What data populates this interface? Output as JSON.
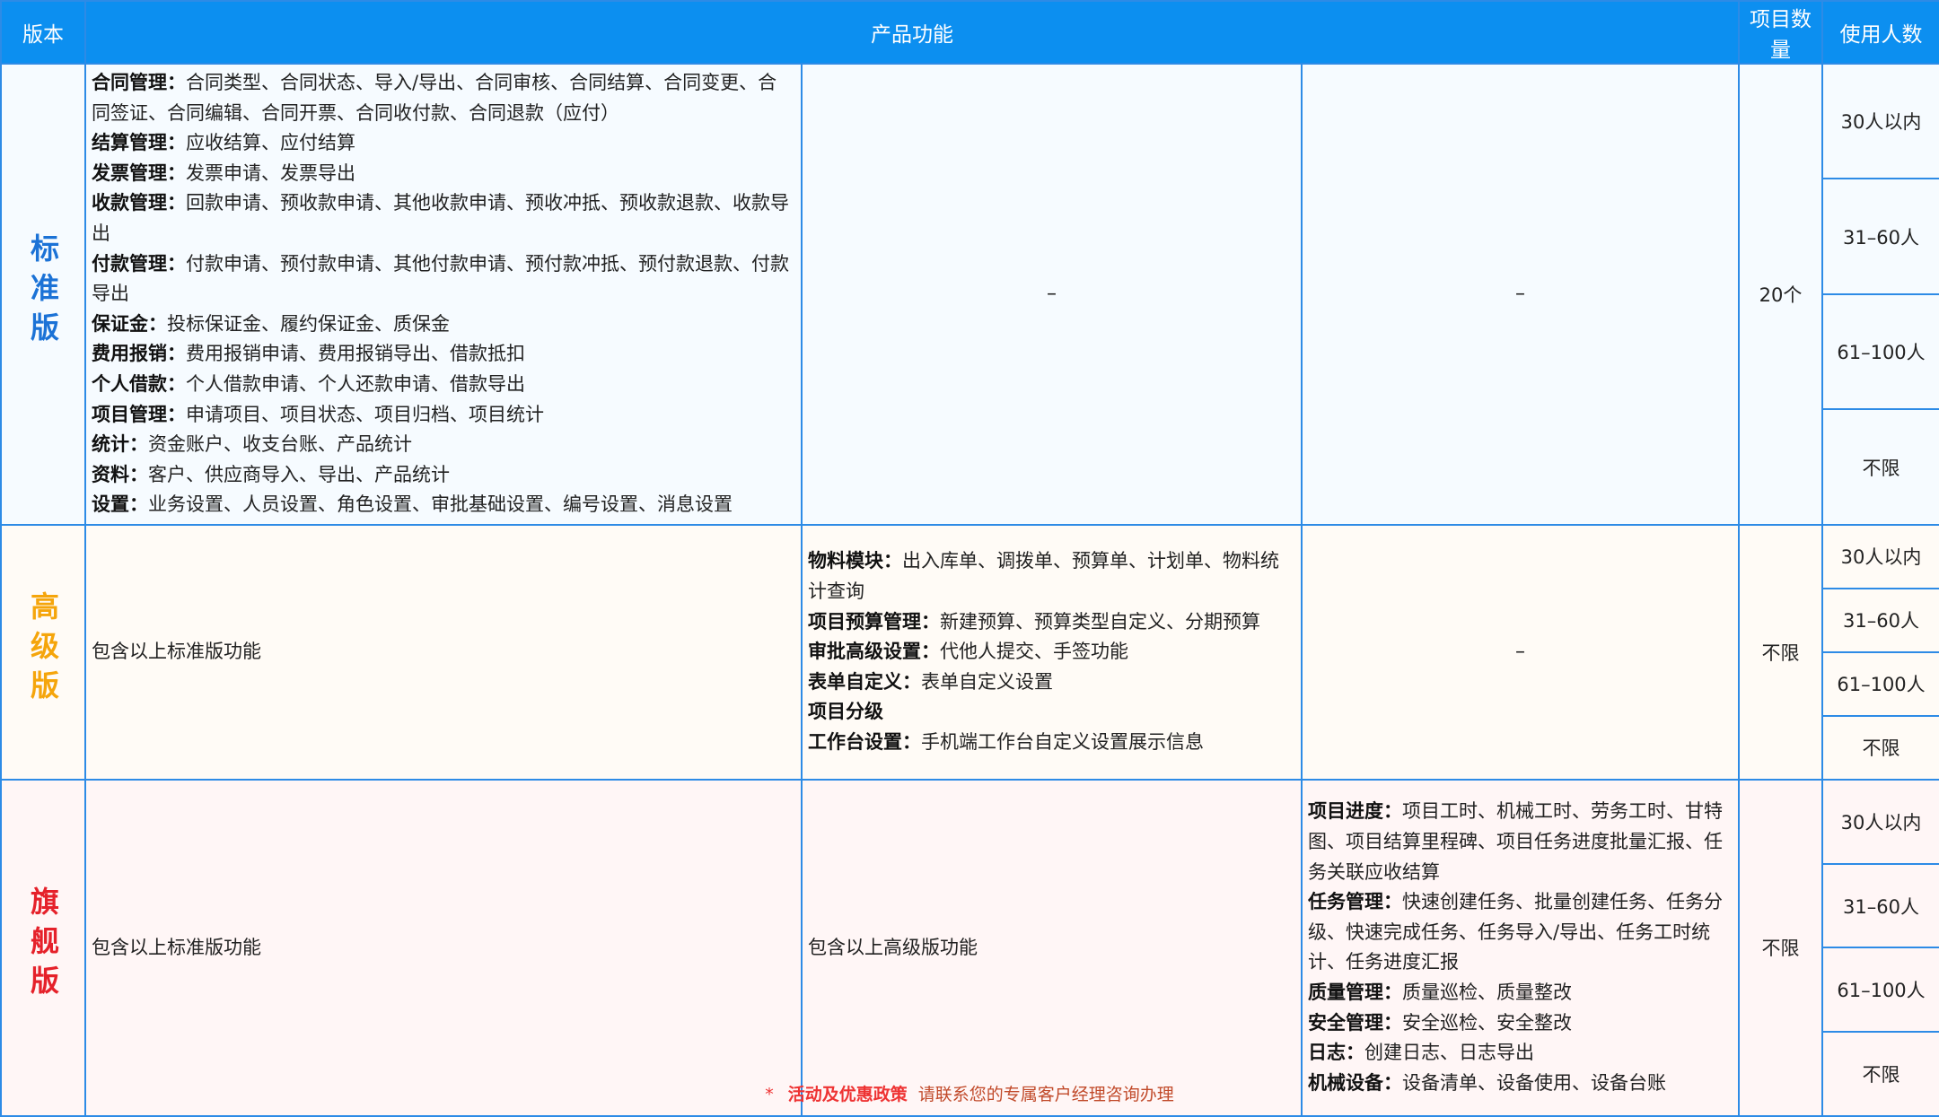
{
  "header": {
    "version": "版本",
    "features": "产品功能",
    "project_count": "项目数量",
    "users": "使用人数"
  },
  "standard": {
    "label": "标准版",
    "features": [
      {
        "k": "合同管理：",
        "v": "合同类型、合同状态、导入/导出、合同审核、合同结算、合同变更、合同签证、合同编辑、合同开票、合同收付款、合同退款（应付）"
      },
      {
        "k": "结算管理：",
        "v": "应收结算、应付结算"
      },
      {
        "k": "发票管理：",
        "v": "发票申请、发票导出"
      },
      {
        "k": "收款管理：",
        "v": "回款申请、预收款申请、其他收款申请、预收冲抵、预收款退款、收款导出"
      },
      {
        "k": "付款管理：",
        "v": "付款申请、预付款申请、其他付款申请、预付款冲抵、预付款退款、付款导出"
      },
      {
        "k": "保证金：",
        "v": "投标保证金、履约保证金、质保金"
      },
      {
        "k": "费用报销：",
        "v": "费用报销申请、费用报销导出、借款抵扣"
      },
      {
        "k": "个人借款：",
        "v": "个人借款申请、个人还款申请、借款导出"
      },
      {
        "k": "项目管理：",
        "v": "申请项目、项目状态、项目归档、项目统计"
      },
      {
        "k": "统计：",
        "v": "资金账户、收支台账、产品统计"
      },
      {
        "k": "资料：",
        "v": "客户、供应商导入、导出、产品统计"
      },
      {
        "k": "设置：",
        "v": "业务设置、人员设置、角色设置、审批基础设置、编号设置、消息设置"
      }
    ],
    "col2": "–",
    "col3": "–",
    "count": "20个",
    "users": [
      "30人以内",
      "31–60人",
      "61–100人",
      "不限"
    ]
  },
  "advanced": {
    "label": "高级版",
    "col1": "包含以上标准版功能",
    "features": [
      {
        "k": "物料模块：",
        "v": "出入库单、调拨单、预算单、计划单、物料统计查询"
      },
      {
        "k": "项目预算管理：",
        "v": "新建预算、预算类型自定义、分期预算"
      },
      {
        "k": "审批高级设置：",
        "v": "代他人提交、手签功能"
      },
      {
        "k": "表单自定义：",
        "v": "表单自定义设置"
      },
      {
        "k": "项目分级",
        "v": ""
      },
      {
        "k": "工作台设置：",
        "v": "手机端工作台自定义设置展示信息"
      }
    ],
    "col3": "–",
    "count": "不限",
    "users": [
      "30人以内",
      "31–60人",
      "61–100人",
      "不限"
    ]
  },
  "flagship": {
    "label": "旗舰版",
    "col1": "包含以上标准版功能",
    "col2": "包含以上高级版功能",
    "features": [
      {
        "k": "项目进度：",
        "v": "项目工时、机械工时、劳务工时、甘特图、项目结算里程碑、项目任务进度批量汇报、任务关联应收结算"
      },
      {
        "k": "任务管理：",
        "v": "快速创建任务、批量创建任务、任务分级、快速完成任务、任务导入/导出、任务工时统计、任务进度汇报"
      },
      {
        "k": "质量管理：",
        "v": "质量巡检、质量整改"
      },
      {
        "k": "安全管理：",
        "v": "安全巡检、安全整改"
      },
      {
        "k": "日志：",
        "v": "创建日志、日志导出"
      },
      {
        "k": "机械设备：",
        "v": "设备清单、设备使用、设备台账"
      }
    ],
    "count": "不限",
    "users": [
      "30人以内",
      "31–60人",
      "61–100人",
      "不限"
    ]
  },
  "footer": {
    "star": "*",
    "highlight": "活动及优惠政策",
    "text": "请联系您的专属客户经理咨询办理"
  },
  "colors": {
    "header_bg": "#0c8ff0",
    "border": "#2d8be6",
    "standard": "#1b72d6",
    "advanced": "#f5a50b",
    "flagship": "#e5212a"
  }
}
